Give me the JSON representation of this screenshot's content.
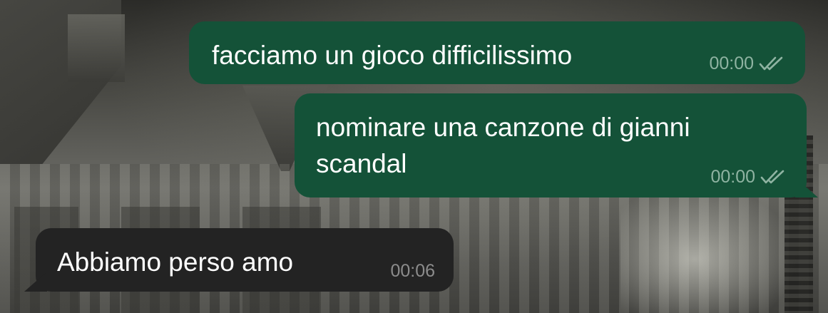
{
  "messages": [
    {
      "direction": "outgoing",
      "text": "facciamo un gioco difficilissimo",
      "time": "00:00",
      "status_icon": "double-check-read-icon"
    },
    {
      "direction": "outgoing",
      "text": "nominare una canzone di gianni scandal",
      "time": "00:00",
      "status_icon": "double-check-read-icon"
    },
    {
      "direction": "incoming",
      "text": "Abbiamo perso amo",
      "time": "00:06"
    }
  ],
  "colors": {
    "outgoing_bubble": "#145238",
    "incoming_bubble": "#232323",
    "outgoing_meta": "#8fb3a2",
    "incoming_meta": "#8c8c8c",
    "text": "#ffffff"
  }
}
